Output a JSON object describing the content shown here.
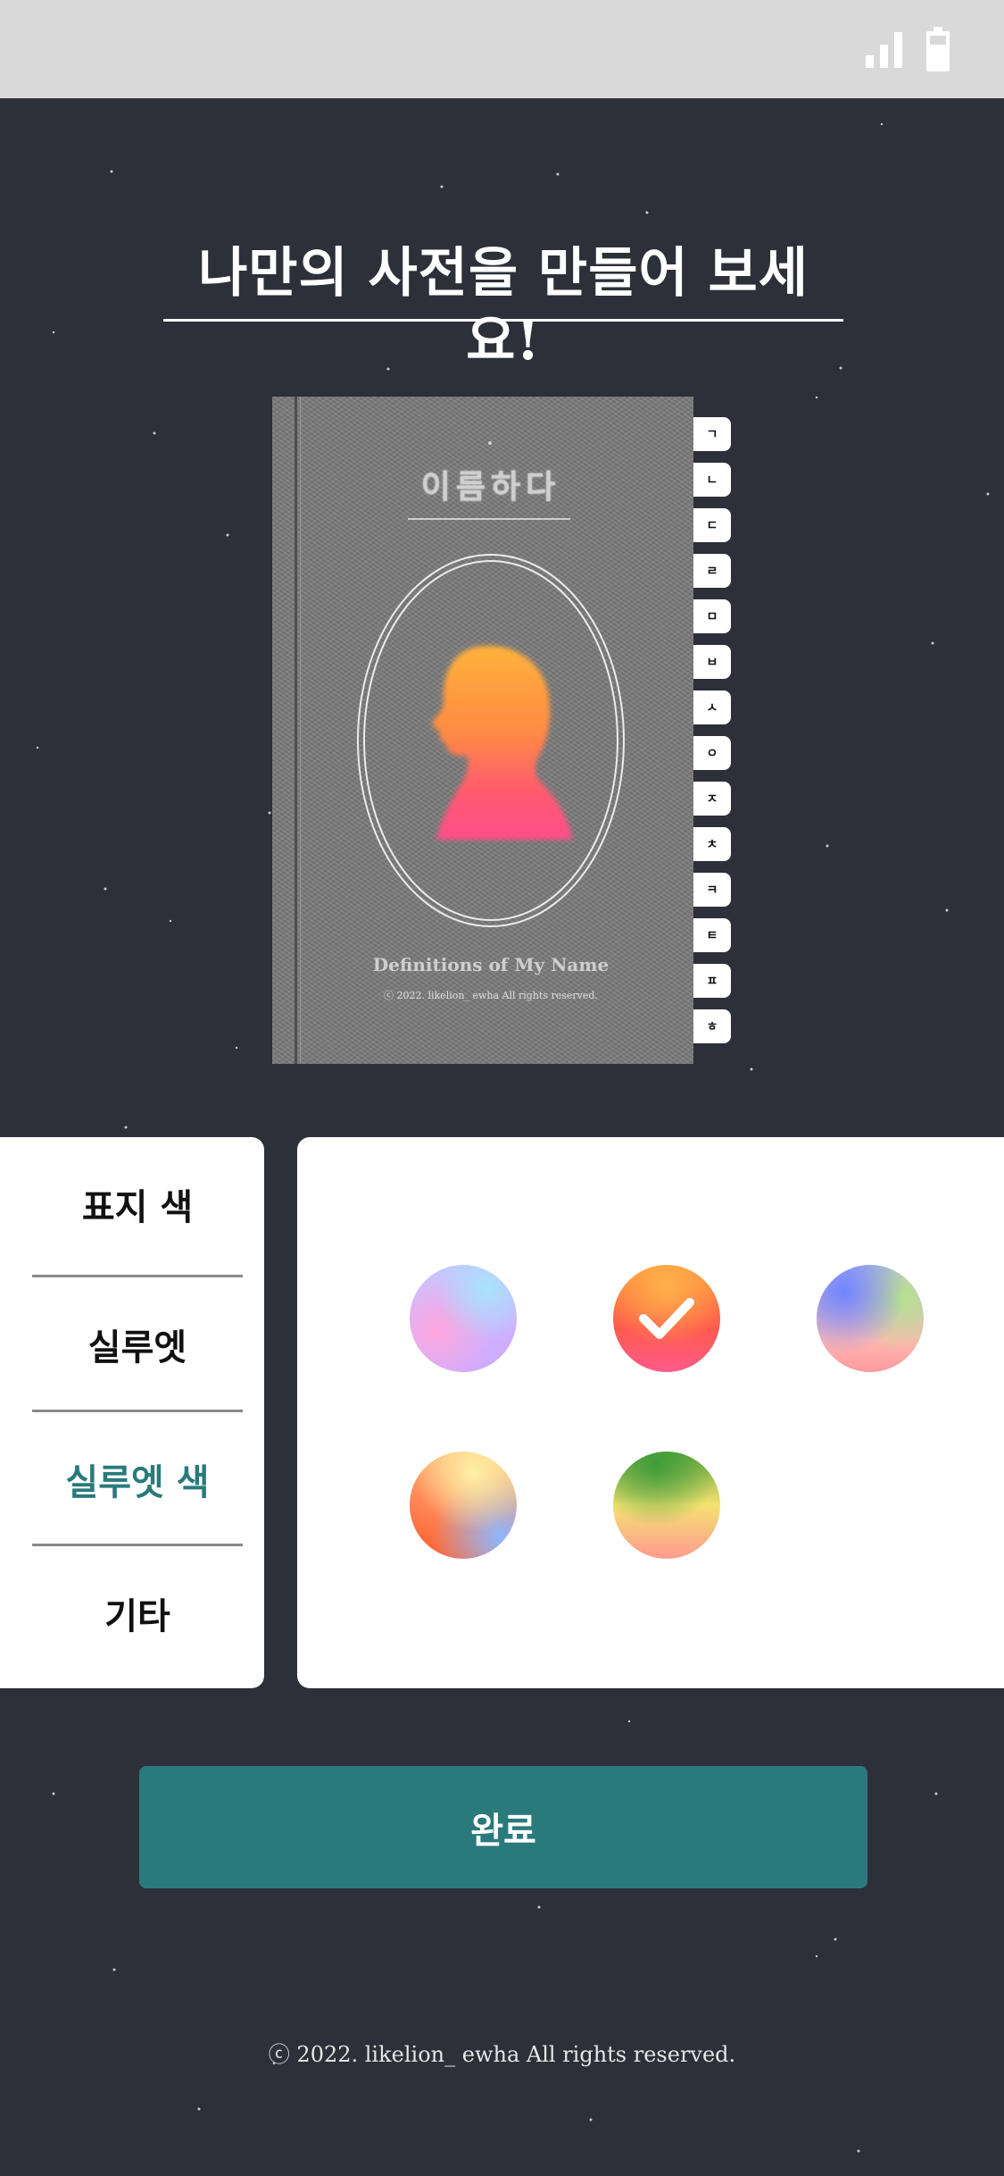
{
  "status_bar": {
    "icons": [
      "signal-icon",
      "battery-icon"
    ]
  },
  "header": {
    "title": "나만의 사전을 만들어 보세요!"
  },
  "book": {
    "title": "이름하다",
    "subtitle": "Definitions of My Name",
    "copyright": "ⓒ 2022. likelion_ ewha All rights reserved.",
    "index_tabs": [
      "ㄱ",
      "ㄴ",
      "ㄷ",
      "ㄹ",
      "ㅁ",
      "ㅂ",
      "ㅅ",
      "ㅇ",
      "ㅈ",
      "ㅊ",
      "ㅋ",
      "ㅌ",
      "ㅍ",
      "ㅎ"
    ]
  },
  "menu": {
    "items": [
      {
        "label": "표지 색"
      },
      {
        "label": "실루엣"
      },
      {
        "label": "실루엣 색",
        "active": true
      },
      {
        "label": "기타"
      }
    ]
  },
  "swatches": {
    "selected_index": 1,
    "colors": [
      {
        "name": "pastel-pink-purple",
        "colors": [
          "#a8e3fb",
          "#ffa6dd",
          "#d1a6ff"
        ]
      },
      {
        "name": "orange-pink",
        "colors": [
          "#ffb04a",
          "#ff5a4f",
          "#ff5a8a"
        ]
      },
      {
        "name": "blue-green-peach",
        "colors": [
          "#6f84ff",
          "#b6e48c",
          "#ff9aa0"
        ]
      },
      {
        "name": "yellow-orange-blue",
        "colors": [
          "#fff0a6",
          "#ff5a2a",
          "#8db6ff"
        ]
      },
      {
        "name": "green-yellow-pink",
        "colors": [
          "#3f9c3a",
          "#f5e270",
          "#ff9a90"
        ]
      }
    ]
  },
  "actions": {
    "done_label": "완료"
  },
  "footer": {
    "text": "ⓒ 2022. likelion_ ewha All rights reserved."
  },
  "theme": {
    "background": "#2d2f39",
    "accent": "#2a7a7c",
    "book_cover": "#7b7b7b"
  }
}
